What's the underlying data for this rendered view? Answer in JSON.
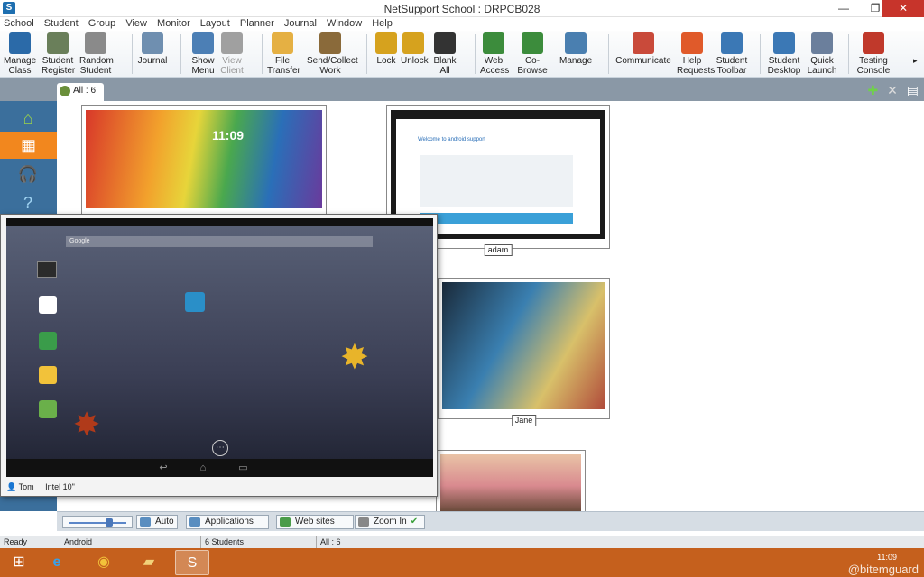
{
  "window": {
    "title": "NetSupport School : DRPCB028",
    "app_icon": "netsupport-icon",
    "controls": [
      "minimize",
      "restore",
      "close"
    ]
  },
  "menu": [
    "School",
    "Student",
    "Group",
    "View",
    "Monitor",
    "Layout",
    "Planner",
    "Journal",
    "Window",
    "Help"
  ],
  "toolbar": [
    {
      "label": "Manage\nClass",
      "icon": "manage-class-icon",
      "color": "#2b6aa8"
    },
    {
      "label": "Student\nRegister",
      "icon": "student-register-icon",
      "color": "#6a7f5a"
    },
    {
      "label": "Random\nStudent",
      "icon": "dice-icon",
      "color": "#8a8a8a"
    },
    {
      "label": "Journal",
      "icon": "journal-icon",
      "color": "#6f8fb0"
    },
    {
      "label": "Show\nMenu",
      "icon": "show-icon",
      "color": "#4c7fb5"
    },
    {
      "label": "View\nClient",
      "icon": "view-client-icon",
      "color": "#a0a0a0"
    },
    {
      "label": "File\nTransfer",
      "icon": "file-transfer-icon",
      "color": "#e5b043"
    },
    {
      "label": "Send/Collect\nWork",
      "icon": "send-collect-icon",
      "color": "#8a6a3a"
    },
    {
      "label": "Lock",
      "icon": "lock-icon",
      "color": "#d6a21e"
    },
    {
      "label": "Unlock",
      "icon": "unlock-icon",
      "color": "#d6a21e"
    },
    {
      "label": "Blank\nAll",
      "icon": "blank-screen-icon",
      "color": "#333333"
    },
    {
      "label": "Web\nAccess",
      "icon": "web-access-icon",
      "color": "#3c8c3c"
    },
    {
      "label": "Co-Browse",
      "icon": "co-browse-icon",
      "color": "#3c8c3c"
    },
    {
      "label": "Manage",
      "icon": "manage-icon",
      "color": "#4a7fb0"
    },
    {
      "label": "Communicate",
      "icon": "communicate-icon",
      "color": "#c94a3a"
    },
    {
      "label": "Help\nRequests",
      "icon": "lifebuoy-icon",
      "color": "#e05a2a"
    },
    {
      "label": "Student\nToolbar",
      "icon": "student-toolbar-icon",
      "color": "#3b78b5"
    },
    {
      "label": "Student\nDesktop",
      "icon": "student-desktop-icon",
      "color": "#3b78b5"
    },
    {
      "label": "Quick\nLaunch",
      "icon": "rocket-icon",
      "color": "#6b7f9c"
    },
    {
      "label": "Testing\nConsole",
      "icon": "testing-console-icon",
      "color": "#c0392b"
    }
  ],
  "tab": {
    "label": "All : 6"
  },
  "left_nav": [
    "home-icon",
    "thumbnails-icon",
    "headphones-icon",
    "help-icon"
  ],
  "thumbnails": [
    {
      "name": "",
      "clock": "11:09"
    },
    {
      "name": "adam",
      "page_heading": "Welcome to android support"
    },
    {
      "name": "Jane"
    },
    {
      "name": ""
    }
  ],
  "popup": {
    "user": "Tom",
    "device": "Intel 10\"",
    "search_placeholder": "Google"
  },
  "viewbar": {
    "auto": "Auto",
    "applications": "Applications",
    "websites": "Web sites",
    "zoom": "Zoom In",
    "zoom_level": 0.7
  },
  "status": {
    "ready": "Ready",
    "group": "Android",
    "students": "6 Students",
    "all": "All : 6"
  },
  "taskbar": {
    "items": [
      "ie-icon",
      "chrome-icon",
      "file-explorer-icon",
      "netsupport-icon"
    ],
    "time": "11:09",
    "watermark": "@bitemguard"
  },
  "colors": {
    "accent": "#f2871e",
    "nav": "#3b6f9c",
    "taskbar": "#c5601d"
  }
}
